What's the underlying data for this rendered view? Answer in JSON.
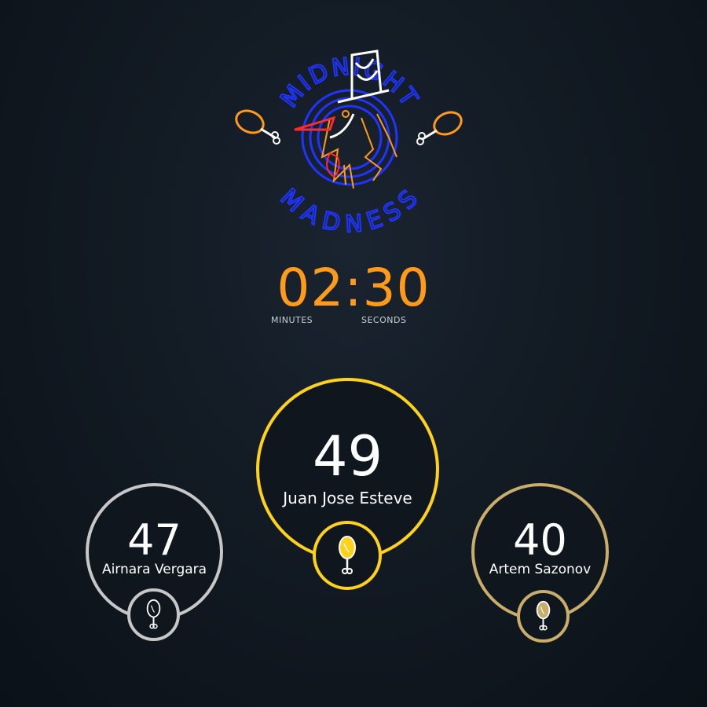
{
  "logo": {
    "top_text": "MIDNIGHT",
    "bottom_text": "MADNESS",
    "icon": "rooster-top-hat-neon-logo",
    "colors": {
      "ring": "#1f34ff",
      "beak": "#ff2a2a",
      "feathers": "#ff9a1a",
      "hat": "#ffffff"
    }
  },
  "timer": {
    "value": "02:30",
    "minutes_label": "MINUTES",
    "seconds_label": "SECONDS",
    "color": "#ff9a1a"
  },
  "leaderboard": [
    {
      "rank": 1,
      "score": "49",
      "name": "Juan Jose Esteve",
      "color": "#ffd21a",
      "badge_icon": "drumstick-icon"
    },
    {
      "rank": 2,
      "score": "47",
      "name": "Airnara Vergara",
      "color": "#c7c7c7",
      "badge_icon": "drumstick-icon"
    },
    {
      "rank": 3,
      "score": "40",
      "name": "Artem Sazonov",
      "color": "#c9ad6a",
      "badge_icon": "drumstick-icon"
    }
  ]
}
